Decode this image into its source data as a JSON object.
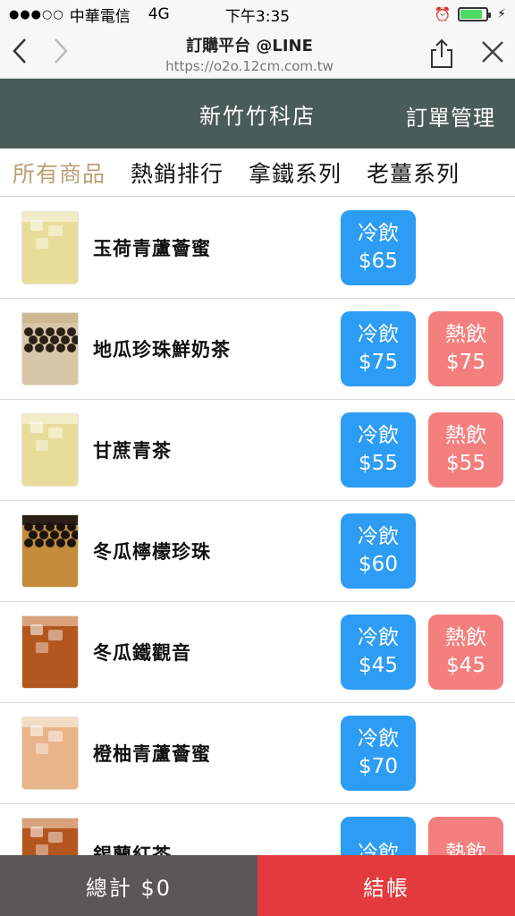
{
  "status_bar": {
    "carrier": "中華電信",
    "network": "4G",
    "time": "下午3:35",
    "battery_level": 0.85
  },
  "browser": {
    "title": "訂購平台 @LINE",
    "url": "https://o2o.12cm.com.tw",
    "back_icon": "chevron-left-icon",
    "forward_icon": "chevron-right-icon",
    "share_icon": "share-icon",
    "close_icon": "close-icon"
  },
  "header": {
    "store_name": "新竹竹科店",
    "order_management": "訂單管理",
    "bg_color": "#4a5c58"
  },
  "tabs": [
    {
      "label": "所有商品",
      "active": true
    },
    {
      "label": "熱銷排行",
      "active": false
    },
    {
      "label": "拿鐵系列",
      "active": false
    },
    {
      "label": "老薑系列",
      "active": false
    }
  ],
  "products": [
    {
      "name": "玉荷青蘆薈蜜",
      "drink_style": "light",
      "cold": {
        "label": "冷飲",
        "price": "$65"
      },
      "hot": null
    },
    {
      "name": "地瓜珍珠鮮奶茶",
      "drink_style": "milk-boba",
      "cold": {
        "label": "冷飲",
        "price": "$75"
      },
      "hot": {
        "label": "熱飲",
        "price": "$75"
      }
    },
    {
      "name": "甘蔗青茶",
      "drink_style": "light",
      "cold": {
        "label": "冷飲",
        "price": "$55"
      },
      "hot": {
        "label": "熱飲",
        "price": "$55"
      }
    },
    {
      "name": "冬瓜檸檬珍珠",
      "drink_style": "dark-boba",
      "cold": {
        "label": "冷飲",
        "price": "$60"
      },
      "hot": null
    },
    {
      "name": "冬瓜鐵觀音",
      "drink_style": "amber",
      "cold": {
        "label": "冷飲",
        "price": "$45"
      },
      "hot": {
        "label": "熱飲",
        "price": "$45"
      }
    },
    {
      "name": "橙柚青蘆薈蜜",
      "drink_style": "peach",
      "cold": {
        "label": "冷飲",
        "price": "$70"
      },
      "hot": null
    },
    {
      "name": "錫蘭紅茶",
      "drink_style": "amber",
      "cold": {
        "label": "冷飲",
        "price": ""
      },
      "hot": {
        "label": "熱飲",
        "price": ""
      }
    }
  ],
  "footer": {
    "total_label": "總計 $0",
    "checkout_label": "結帳"
  },
  "colors": {
    "cold_button": "#2d9cf5",
    "hot_button": "#f47f7f",
    "active_tab": "#b9a178",
    "checkout": "#e33b3d",
    "total_bg": "#5c5656"
  }
}
